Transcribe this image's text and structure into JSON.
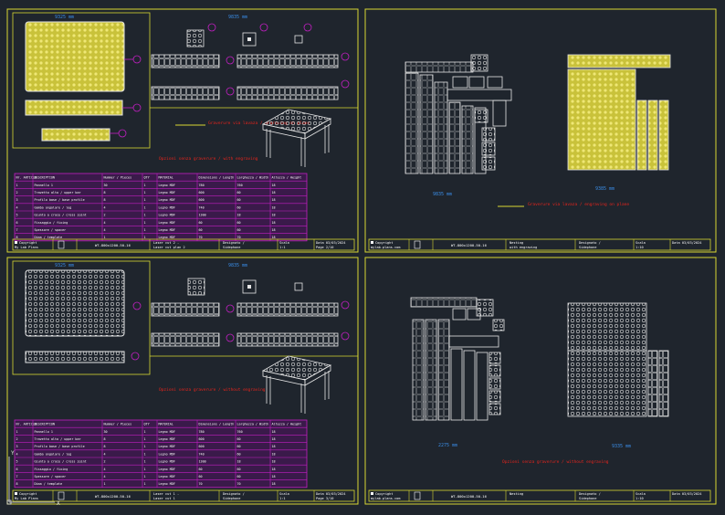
{
  "colors": {
    "background": "#1f252d",
    "frame": "#d8d832",
    "part": "#e6e6e6",
    "engrave": "#d9d24a",
    "table": "#c21fc2",
    "tableText": "#ffffff",
    "note": "#e8241c",
    "dim": "#3a8de6",
    "block": "#ffffff"
  },
  "sheets": [
    {
      "id": "sheet-1",
      "dims": {
        "top": "9835 mm",
        "left": "9325 mm"
      },
      "note_red": "Opzioni senza graverure / with engraving",
      "callout": "Graverure via lavaza / engraving on plane",
      "table_headers": [
        "Nr. ARTICLE",
        "DESCRIPTION",
        "Nummer / Pieces",
        "QTY",
        "MATERIAL",
        "Dimensions / Length",
        "Larghezza / Width",
        "Altezza / Height"
      ],
      "table_rows": [
        [
          "1",
          "Pannello 1",
          "30",
          "1",
          "Legno MDF",
          "780",
          "760",
          "18"
        ],
        [
          "2",
          "Travetto alto / upper bar",
          "8",
          "1",
          "Legno MDF",
          "600",
          "60",
          "18"
        ],
        [
          "3",
          "Profilo base / base profile",
          "8",
          "1",
          "Legno MDF",
          "600",
          "60",
          "18"
        ],
        [
          "4",
          "Gamba angolare / leg",
          "4",
          "1",
          "Legno MDF",
          "740",
          "60",
          "18"
        ],
        [
          "5",
          "Giunto a croce / cross joint",
          "2",
          "1",
          "Legno MDF",
          "1300",
          "18",
          "18"
        ],
        [
          "6",
          "Fissaggio / fixing",
          "4",
          "1",
          "Legno MDF",
          "60",
          "60",
          "18"
        ],
        [
          "7",
          "Spessore / spacer",
          "4",
          "1",
          "Legno MDF",
          "60",
          "60",
          "18"
        ],
        [
          "8",
          "Dima / template",
          "1",
          "1",
          "Legno MDF",
          "70",
          "70",
          "18"
        ]
      ],
      "title_block": {
        "copyright": "Copyright",
        "site": "My Lab Plans",
        "code": "WT-800x1200-50-16",
        "layer_1": "Laser cut 2 -",
        "layer_2": "Laser cut plan 2",
        "designer_label": "Designato /",
        "designer": "Sidephone",
        "scale_label": "Scala",
        "scale": "1:1",
        "date_label": "Data",
        "date": "03/03/2024",
        "page": "Page 2/10"
      }
    },
    {
      "id": "sheet-2",
      "dims": {
        "left": "9835 mm",
        "right": "9385 mm"
      },
      "callout": "Graverure via lavaza / engraving on plane",
      "title_block": {
        "copyright": "Copyright",
        "site": "mylab-plans.com",
        "code": "WT-800x1200-50-16",
        "layer_1": "Nesting",
        "layer_2": "with engraving",
        "designer_label": "Designato /",
        "designer": "Sidephone",
        "scale_label": "Scala",
        "scale": "1:10",
        "date_label": "Data",
        "date": "03/03/2024"
      }
    },
    {
      "id": "sheet-3",
      "dims": {
        "top": "9835 mm",
        "left": "9325 mm"
      },
      "note_red": "Opzioni senza graverure / without engraving",
      "table_headers": [
        "Nr. ARTICLE",
        "DESCRIPTION",
        "Nummer / Pieces",
        "QTY",
        "MATERIAL",
        "Dimensions / Length",
        "Larghezza / Width",
        "Altezza / Height"
      ],
      "table_rows": [
        [
          "1",
          "Pannello 1",
          "30",
          "1",
          "Legno MDF",
          "780",
          "760",
          "18"
        ],
        [
          "2",
          "Travetto alto / upper bar",
          "8",
          "1",
          "Legno MDF",
          "600",
          "60",
          "18"
        ],
        [
          "3",
          "Profilo base / base profile",
          "8",
          "1",
          "Legno MDF",
          "600",
          "60",
          "18"
        ],
        [
          "4",
          "Gamba angolare / leg",
          "4",
          "1",
          "Legno MDF",
          "740",
          "60",
          "18"
        ],
        [
          "5",
          "Giunto a croce / cross joint",
          "2",
          "1",
          "Legno MDF",
          "1300",
          "18",
          "18"
        ],
        [
          "6",
          "Fissaggio / fixing",
          "4",
          "1",
          "Legno MDF",
          "60",
          "60",
          "18"
        ],
        [
          "7",
          "Spessore / spacer",
          "4",
          "1",
          "Legno MDF",
          "60",
          "60",
          "18"
        ],
        [
          "8",
          "Dima / template",
          "1",
          "1",
          "Legno MDF",
          "70",
          "70",
          "18"
        ]
      ],
      "title_block": {
        "copyright": "Copyright",
        "site": "My Lab Plans",
        "code": "WT-800x1200-50-16",
        "layer_1": "Laser cut 1 -",
        "layer_2": "Laser cut 1",
        "designer_label": "Designato /",
        "designer": "Sidephone",
        "scale_label": "Scala",
        "scale": "1:1",
        "date_label": "Data",
        "date": "03/03/2024",
        "page": "Page 3/10"
      }
    },
    {
      "id": "sheet-4",
      "dims": {
        "left": "2275 mm",
        "right": "9335 mm"
      },
      "note_red": "Opzioni senza graverure / without engraving",
      "title_block": {
        "copyright": "Copyright",
        "site": "mylab-plans.com",
        "code": "WT-800x1200-50-16",
        "layer_1": "Nesting",
        "layer_2": "",
        "designer_label": "Designato /",
        "designer": "Sidephone",
        "scale_label": "Scala",
        "scale": "1:10",
        "date_label": "Data",
        "date": "03/03/2024"
      }
    }
  ],
  "ucs": {
    "x": "X",
    "y": "Y"
  }
}
